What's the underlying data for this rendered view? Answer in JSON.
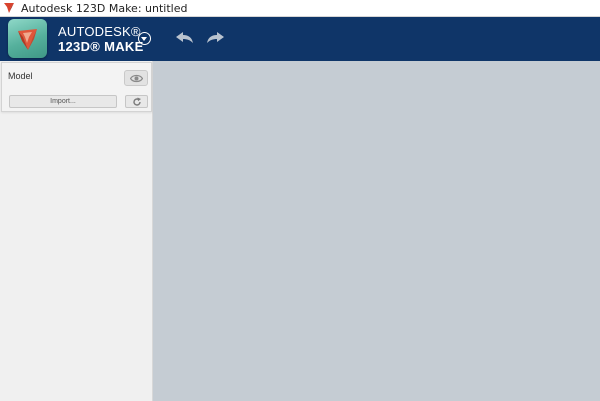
{
  "window": {
    "title": "Autodesk 123D Make: untitled",
    "app_icon": "autodesk-app-icon"
  },
  "header": {
    "brand_line1": "AUTODESK®",
    "brand_line2": "123D® MAKE",
    "logo_icon": "123d-make-logo-icon",
    "menu_icon": "chevron-down-circle-icon",
    "undo_icon": "undo-arrow-icon",
    "redo_icon": "redo-arrow-icon",
    "bg_color": "#0f3568"
  },
  "sidebar": {
    "model_panel": {
      "label": "Model",
      "visibility_icon": "eye-icon",
      "import_label": "Import...",
      "refresh_icon": "refresh-icon"
    }
  },
  "canvas": {
    "bg_color": "#c5ccd3"
  }
}
